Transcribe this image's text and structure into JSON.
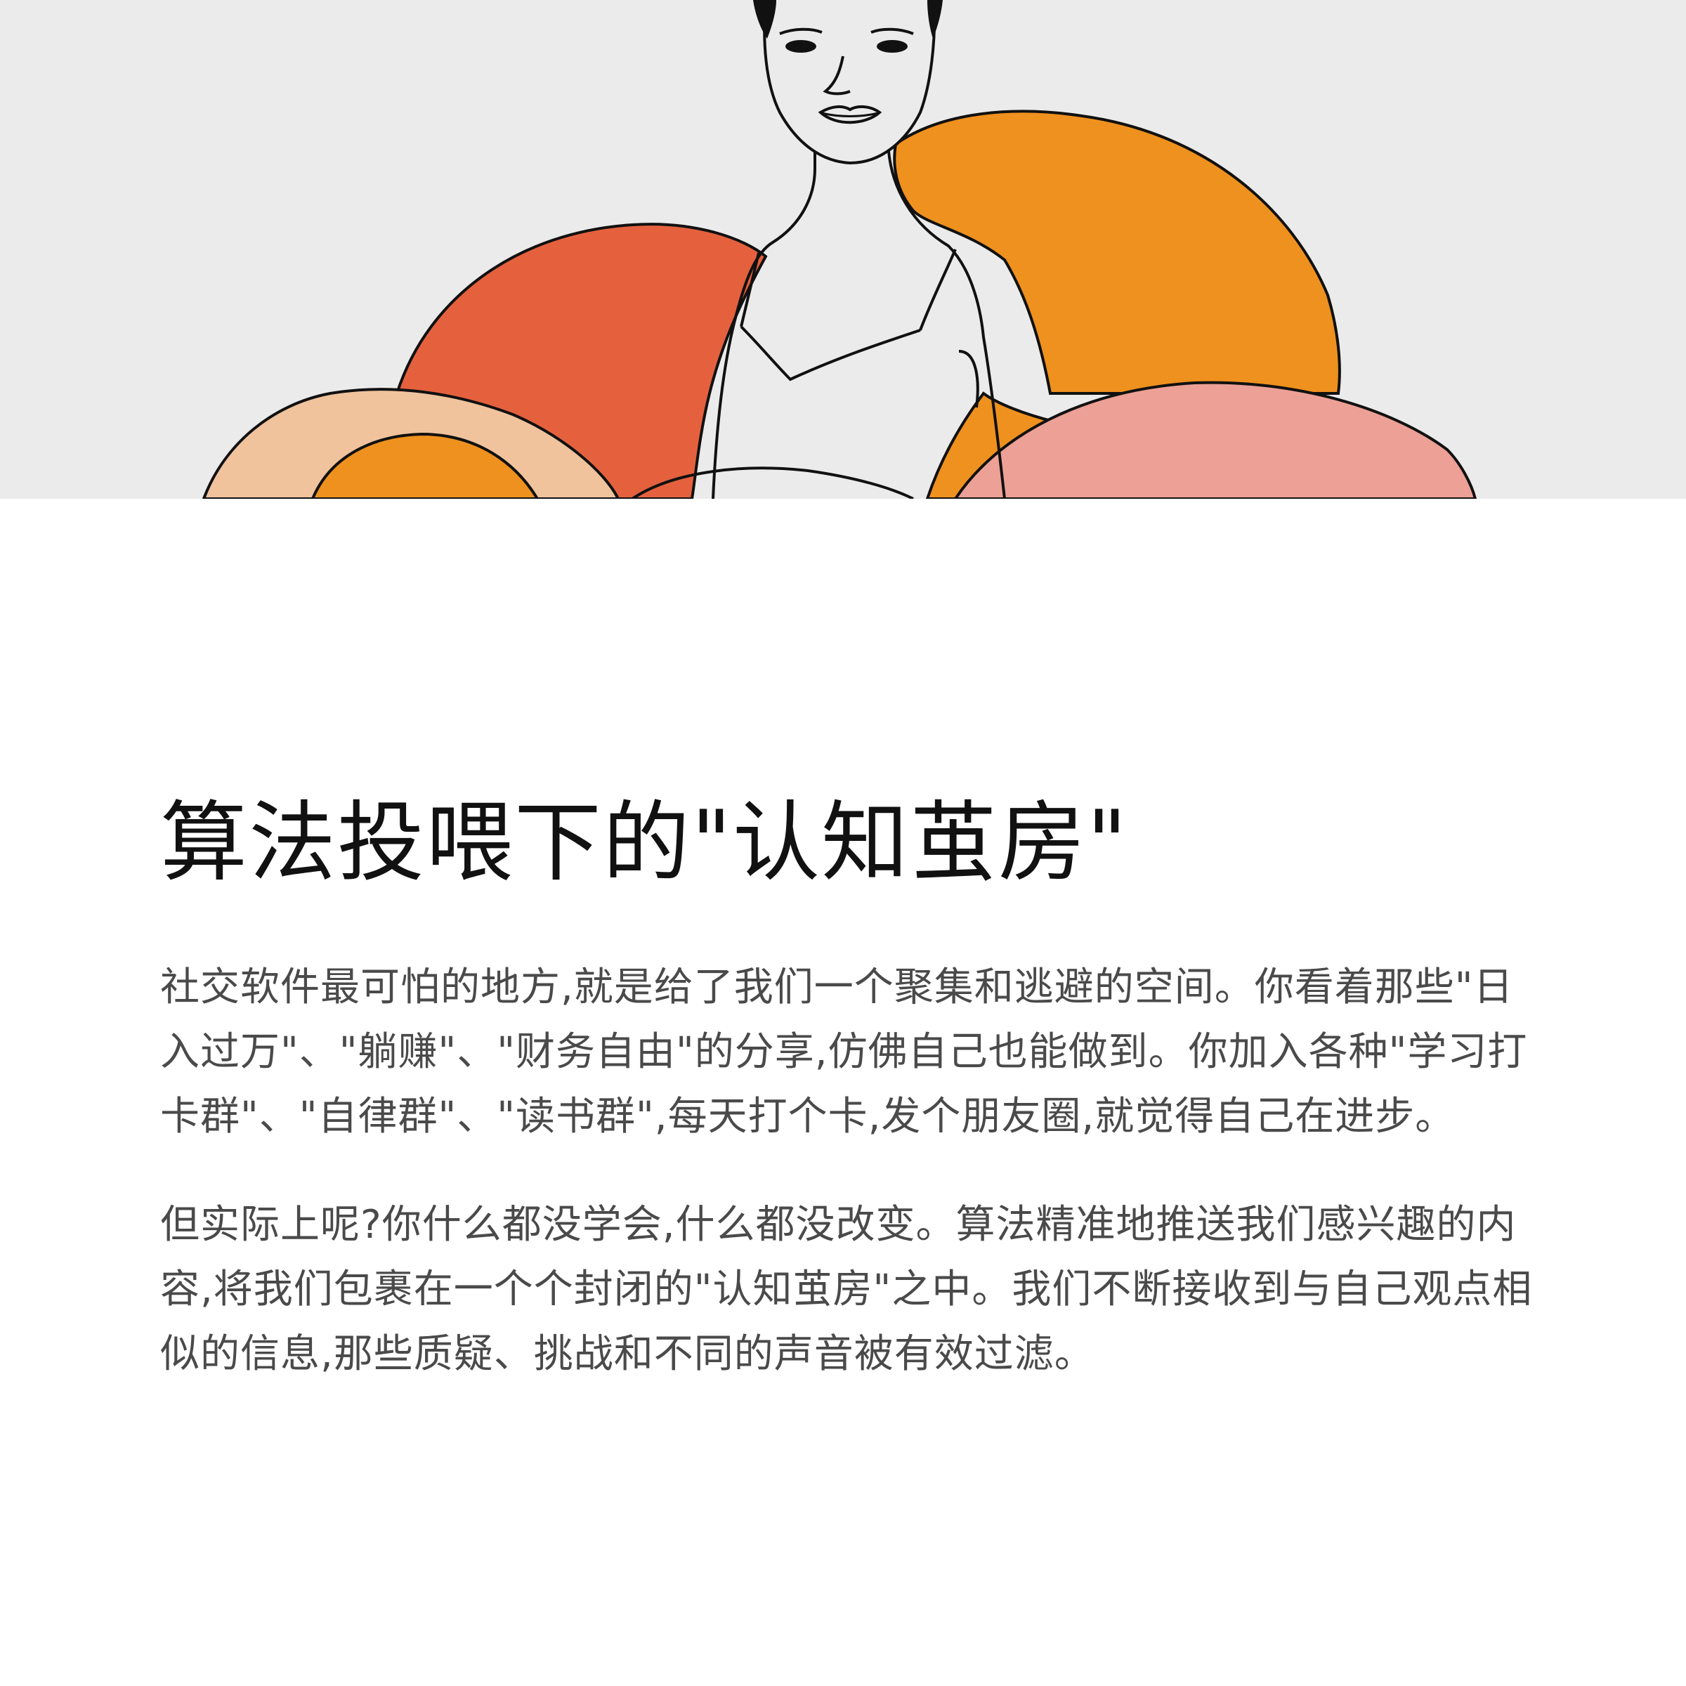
{
  "illustration": {
    "colors": {
      "background": "#ebebeb",
      "red_orange": "#e5613e",
      "orange": "#ef911e",
      "peach": "#f0c39d",
      "pink": "#eda095",
      "outline": "#111111"
    }
  },
  "article": {
    "title": "算法投喂下的\"认知茧房\"",
    "paragraphs": [
      "社交软件最可怕的地方,就是给了我们一个聚集和逃避的空间。你看着那些\"日入过万\"、\"躺赚\"、\"财务自由\"的分享,仿佛自己也能做到。你加入各种\"学习打卡群\"、\"自律群\"、\"读书群\",每天打个卡,发个朋友圈,就觉得自己在进步。",
      "但实际上呢?你什么都没学会,什么都没改变。算法精准地推送我们感兴趣的内容,将我们包裹在一个个封闭的\"认知茧房\"之中。我们不断接收到与自己观点相似的信息,那些质疑、挑战和不同的声音被有效过滤。"
    ]
  }
}
